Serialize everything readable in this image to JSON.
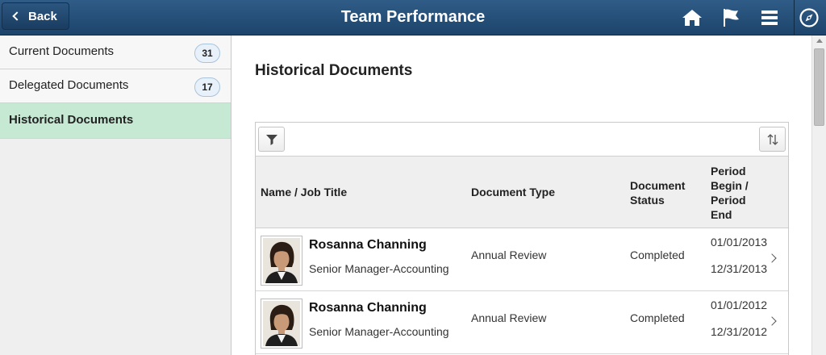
{
  "header": {
    "back_label": "Back",
    "title": "Team Performance",
    "icons": [
      "home-icon",
      "flag-icon",
      "menu-icon",
      "compass-icon"
    ]
  },
  "sidebar": {
    "items": [
      {
        "label": "Current Documents",
        "count": "31",
        "active": false
      },
      {
        "label": "Delegated Documents",
        "count": "17",
        "active": false
      },
      {
        "label": "Historical Documents",
        "count": "",
        "active": true
      }
    ]
  },
  "main": {
    "title": "Historical Documents",
    "toolbar": {
      "filter_icon": "filter-icon",
      "sort_icon": "sort-icon"
    },
    "columns": {
      "name": "Name / Job Title",
      "type": "Document Type",
      "status_line1": "Document",
      "status_line2": "Status",
      "period_line1": "Period",
      "period_line2": "Begin /",
      "period_line3": "Period",
      "period_line4": "End"
    },
    "rows": [
      {
        "name": "Rosanna Channing",
        "job_title": "Senior Manager-Accounting",
        "doc_type": "Annual Review",
        "status": "Completed",
        "begin": "01/01/2013",
        "end": "12/31/2013"
      },
      {
        "name": "Rosanna Channing",
        "job_title": "Senior Manager-Accounting",
        "doc_type": "Annual Review",
        "status": "Completed",
        "begin": "01/01/2012",
        "end": "12/31/2012"
      }
    ]
  },
  "colors": {
    "header": "#1d446b",
    "active_nav": "#c6e9d3",
    "badge_border": "#a9c3da"
  }
}
